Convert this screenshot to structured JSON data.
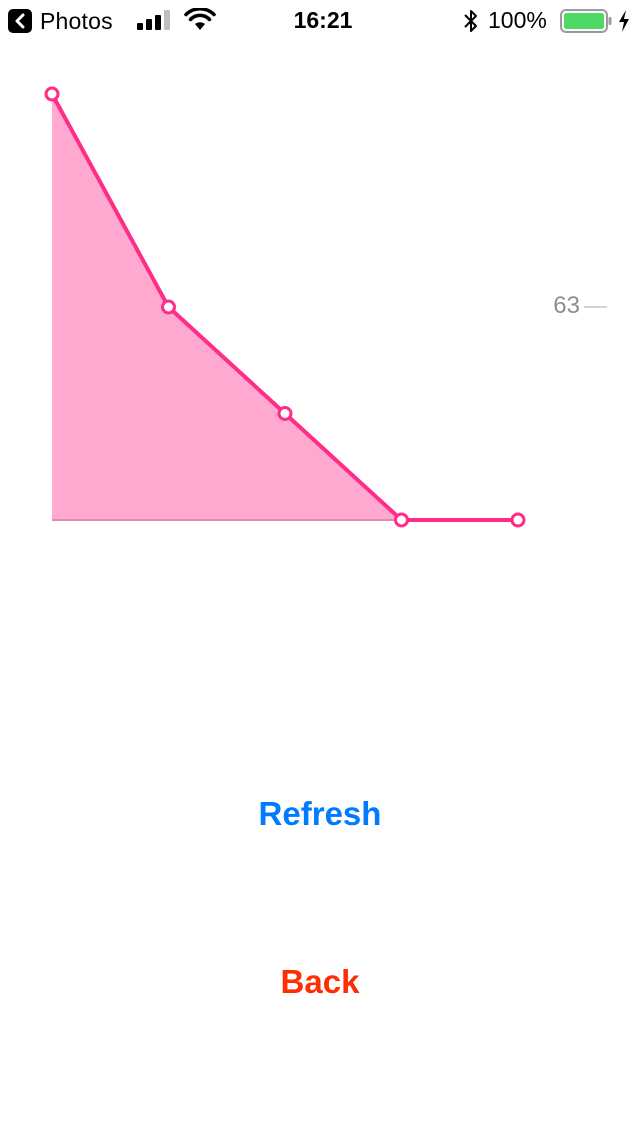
{
  "status_bar": {
    "back_app_label": "Photos",
    "time": "16:21",
    "battery_percent": "100%",
    "signal_bars": 3,
    "signal_bars_total": 4,
    "battery_level": 1.0,
    "charging": true,
    "icons": [
      "back-arrow-icon",
      "signal-icon",
      "wifi-icon",
      "bluetooth-icon",
      "battery-icon",
      "charging-bolt-icon"
    ]
  },
  "chart_data": {
    "type": "area",
    "x": [
      0,
      1,
      2,
      3,
      4
    ],
    "values": [
      126,
      63,
      31.5,
      0,
      0
    ],
    "ylim": [
      0,
      126
    ],
    "yticks": [
      63
    ],
    "ytick_labels": [
      "63"
    ],
    "xlabel": "",
    "ylabel": "",
    "grid": false,
    "colors": {
      "line": "#ff2d87",
      "fill": "#ffa8d0",
      "marker_fill": "#ffffff",
      "baseline": "#e08ab5",
      "tick": "#8e8e93"
    }
  },
  "buttons": {
    "refresh_label": "Refresh",
    "back_label": "Back",
    "refresh_color": "#007aff",
    "back_color": "#ff2d00"
  }
}
